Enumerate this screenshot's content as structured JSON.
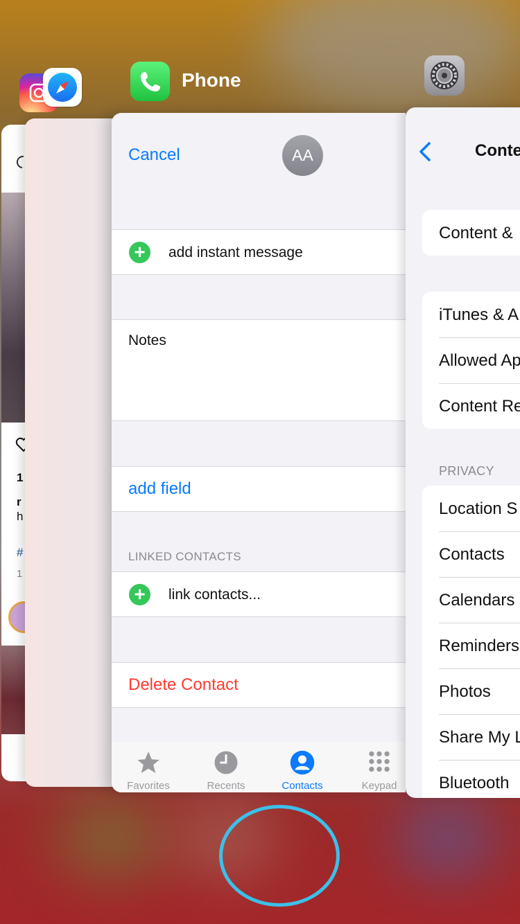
{
  "switcher": {
    "active_app_title": "Phone"
  },
  "instagram_card": {
    "caption_line1": "1",
    "caption_line2": "r",
    "caption_line3": "h",
    "hashtag": "#",
    "date_line": "1"
  },
  "phone_card": {
    "cancel_label": "Cancel",
    "avatar_initials": "AA",
    "add_instant_message_label": "add instant message",
    "notes_label": "Notes",
    "add_field_label": "add field",
    "linked_contacts_header": "LINKED CONTACTS",
    "link_contacts_label": "link contacts...",
    "delete_contact_label": "Delete Contact",
    "tabs": [
      {
        "label": "Favorites",
        "icon": "star-icon",
        "active": false
      },
      {
        "label": "Recents",
        "icon": "clock-icon",
        "active": false
      },
      {
        "label": "Contacts",
        "icon": "person-icon",
        "active": true
      },
      {
        "label": "Keypad",
        "icon": "keypad-icon",
        "active": false
      }
    ]
  },
  "settings_card": {
    "title": "Conte",
    "group1": [
      "Content &"
    ],
    "group2": [
      "iTunes & A",
      "Allowed Ap",
      "Content Re"
    ],
    "privacy_header": "PRIVACY",
    "privacy_items": [
      "Location S",
      "Contacts",
      "Calendars",
      "Reminders",
      "Photos",
      "Share My L",
      "Bluetooth"
    ]
  },
  "colors": {
    "accent_blue": "#0a7aff",
    "destructive_red": "#ff3b30",
    "add_green": "#35c759",
    "highlight_ring": "#3cc0ea"
  }
}
